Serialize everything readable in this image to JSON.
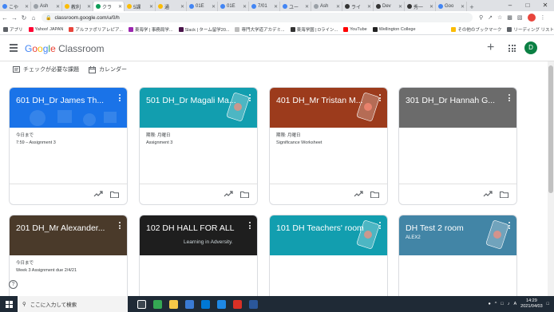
{
  "browser": {
    "tabs": [
      {
        "label": "こや",
        "color": "#4285f4"
      },
      {
        "label": "Ash",
        "color": "#9aa0a6"
      },
      {
        "label": "教利",
        "color": "#fbbc05"
      },
      {
        "label": "クラ",
        "color": "#0f9d58",
        "active": true
      },
      {
        "label": "5課",
        "color": "#fbbc05"
      },
      {
        "label": "通　",
        "color": "#fbbc05"
      },
      {
        "label": "01E",
        "color": "#4285f4"
      },
      {
        "label": "01E",
        "color": "#4285f4"
      },
      {
        "label": "7/01",
        "color": "#4285f4"
      },
      {
        "label": "ユー",
        "color": "#4285f4"
      },
      {
        "label": "Ash",
        "color": "#9aa0a6"
      },
      {
        "label": "ライ",
        "color": "#333333"
      },
      {
        "label": "Dev",
        "color": "#333333"
      },
      {
        "label": "秀一",
        "color": "#333333"
      },
      {
        "label": "Goo",
        "color": "#4285f4"
      }
    ],
    "url": "classroom.google.com/u/0/h",
    "window_controls": [
      "–",
      "□",
      "✕"
    ],
    "profile_initial": "D"
  },
  "bookmarks": [
    {
      "label": "アプリ",
      "color": "#5f6368"
    },
    {
      "label": "Yahoo! JAPAN",
      "color": "#ff0033"
    },
    {
      "label": "アルファポリアレピア...",
      "color": "#e8453c"
    },
    {
      "label": "東海学 | 事務局学...",
      "color": "#9c27b0"
    },
    {
      "label": "Slack | ターム留学20...",
      "color": "#4a154b"
    },
    {
      "label": "専門大学道アカデミ...",
      "color": "#bdbdbd"
    },
    {
      "label": "東海学園 | Dライン...",
      "color": "#333333"
    },
    {
      "label": "YouTube",
      "color": "#ff0000"
    },
    {
      "label": "Wellington College",
      "color": "#222222"
    },
    {
      "label": "その他のブックマーク",
      "color": "#fbbc05"
    },
    {
      "label": "リーディング リスト",
      "color": "#5f6368"
    }
  ],
  "header": {
    "logo_google": [
      "G",
      "o",
      "o",
      "g",
      "l",
      "e"
    ],
    "logo_product": "Classroom",
    "add_label": "+",
    "account_initial": "D"
  },
  "subnav": {
    "todo_label": "チェックが必要な課題",
    "calendar_label": "カレンダー"
  },
  "cards": [
    {
      "title": "601 DH_Dr James Th...",
      "subtitle": "",
      "banner": "#1a73e8",
      "lines": [
        "今日まで",
        "7:59 – Assignment 3"
      ]
    },
    {
      "title": "501 DH_Dr Magali Ma...",
      "subtitle": "",
      "banner": "#129eaf",
      "lines": [
        "期限: 月曜日",
        "Assignment 3"
      ]
    },
    {
      "title": "401 DH_Mr Tristan M...",
      "subtitle": "",
      "banner": "#9c3b1c",
      "lines": [
        "期限: 月曜日",
        "Significance Worksheet"
      ]
    },
    {
      "title": "301 DH_Dr Hannah G...",
      "subtitle": "",
      "banner": "#6b6b6b",
      "lines": []
    },
    {
      "title": "201 DH_Mr Alexander...",
      "subtitle": "",
      "banner": "#4a3a2a",
      "lines": [
        "今日まで",
        "Week 3 Assignment due 2/4/21"
      ]
    },
    {
      "title": "102 DH HALL FOR ALL",
      "subtitle": "",
      "banner": "#1e1e1e",
      "lines": []
    },
    {
      "title": "101 DH Teachers' room",
      "subtitle": "",
      "banner": "#129eaf",
      "lines": []
    },
    {
      "title": "DH Test 2 room",
      "subtitle": "ALEX2",
      "banner": "#4285a6",
      "lines": []
    }
  ],
  "banner_text": "Learning in Adversity.",
  "help_label": "?",
  "taskbar": {
    "search_placeholder": "ここに入力して検索",
    "time": "14:29",
    "date": "2021/04/03",
    "ime": "A"
  }
}
